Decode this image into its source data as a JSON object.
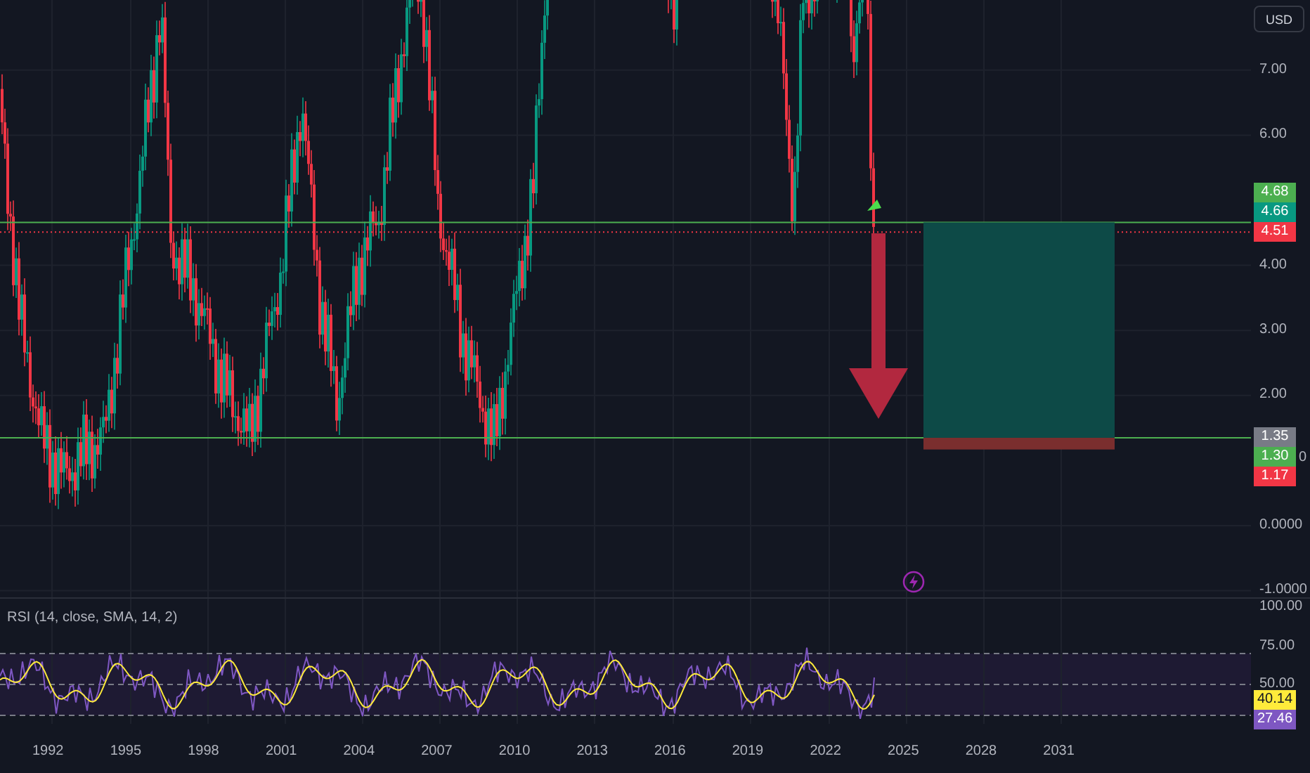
{
  "currency_button": {
    "label": "USD"
  },
  "price_axis": {
    "ticks": [
      "7.00",
      "6.00",
      "4.00",
      "3.00",
      "2.00",
      "0.0000",
      "-1.0000"
    ],
    "badge_groups": [
      {
        "badges": [
          {
            "label": "4.68",
            "color": "#4caf50"
          },
          {
            "label": "4.66",
            "color": "#089981"
          },
          {
            "label": "4.51",
            "color": "#f23645"
          }
        ]
      },
      {
        "badges": [
          {
            "label": "1.35",
            "color": "#787b86"
          },
          {
            "label": "1.30",
            "color": "#4caf50"
          },
          {
            "label": "1.17",
            "color": "#f23645"
          }
        ]
      }
    ],
    "clipped_label": "0"
  },
  "rsi": {
    "title": "RSI (14, close, SMA, 14, 2)",
    "ticks": [
      "100.00",
      "75.00",
      "50.00"
    ],
    "badges": [
      {
        "label": "40.14",
        "color": "#ffeb3b"
      },
      {
        "label": "27.46",
        "color": "#7e57c2"
      }
    ]
  },
  "time_axis": {
    "labels": [
      "1992",
      "1995",
      "1998",
      "2001",
      "2004",
      "2007",
      "2010",
      "2013",
      "2016",
      "2019",
      "2022",
      "2025",
      "2028",
      "2031"
    ]
  }
}
